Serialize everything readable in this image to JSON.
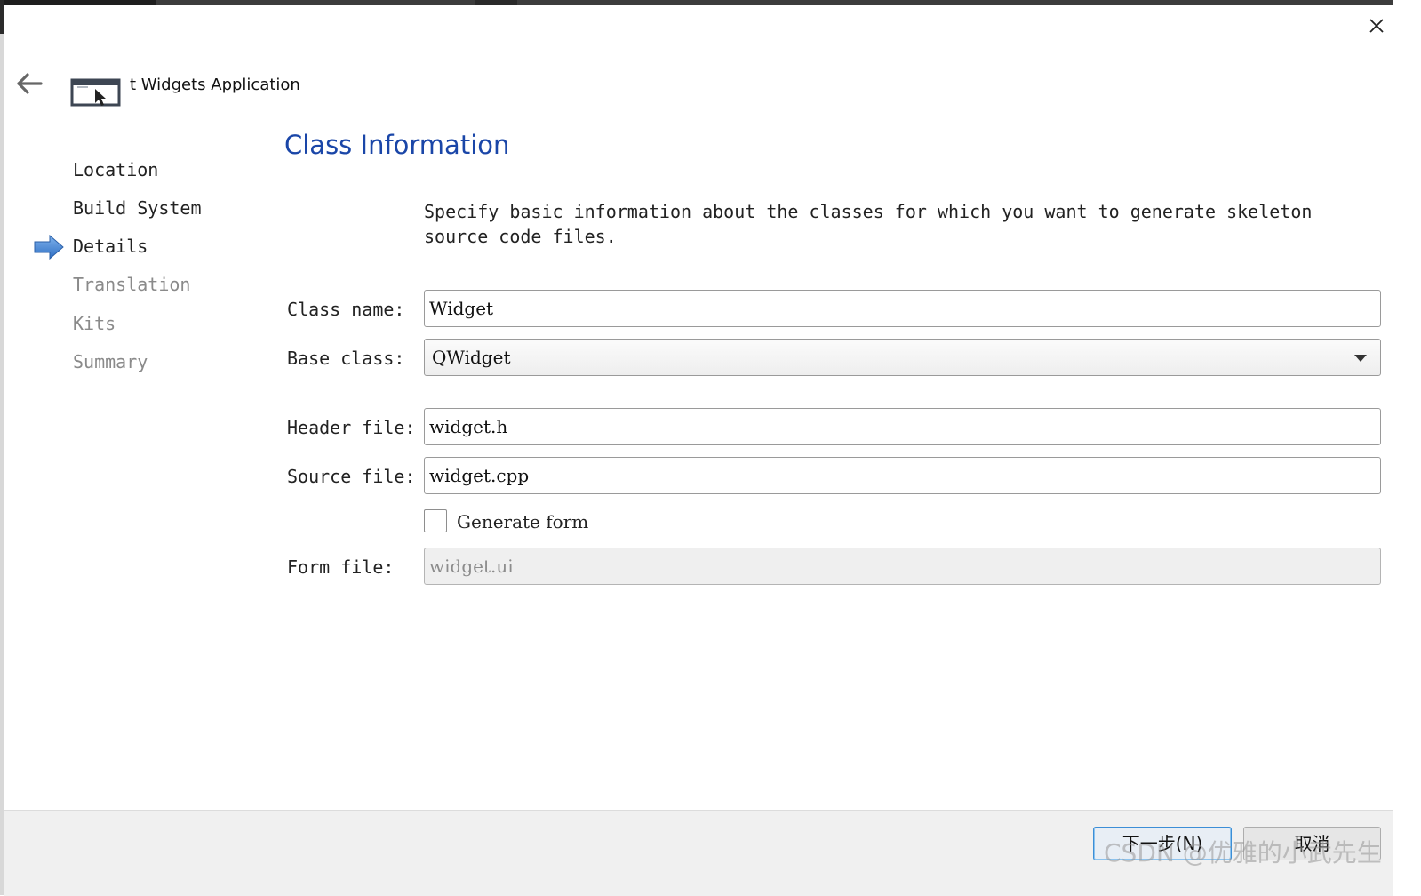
{
  "window": {
    "wizard_title": "t Widgets Application"
  },
  "steps": [
    {
      "label": "Location",
      "state": "done"
    },
    {
      "label": "Build System",
      "state": "done"
    },
    {
      "label": "Details",
      "state": "current"
    },
    {
      "label": "Translation",
      "state": "pending"
    },
    {
      "label": "Kits",
      "state": "pending"
    },
    {
      "label": "Summary",
      "state": "pending"
    }
  ],
  "page": {
    "title": "Class Information",
    "description": "Specify basic information about the classes for which you want to generate skeleton source code files."
  },
  "form": {
    "class_name": {
      "label": "Class name:",
      "value": "Widget"
    },
    "base_class": {
      "label": "Base class:",
      "value": "QWidget"
    },
    "header_file": {
      "label": "Header file:",
      "value": "widget.h"
    },
    "source_file": {
      "label": "Source file:",
      "value": "widget.cpp"
    },
    "generate_form": {
      "label": "Generate form",
      "checked": false
    },
    "form_file": {
      "label": "Form file:",
      "value": "widget.ui",
      "disabled": true
    }
  },
  "footer": {
    "next_label": "下一步(N)",
    "cancel_label": "取消"
  },
  "watermark": "CSDN @优雅的小武先生",
  "colors": {
    "title_blue": "#1a46a8",
    "arrow_blue": "#3a7fd5",
    "disabled_text": "#8a8a8a",
    "footer_bg": "#f0f0f0"
  },
  "icons": {
    "close": "close-icon",
    "back": "arrow-left-icon",
    "app": "window-cursor-icon",
    "current_step": "arrow-right-icon",
    "dropdown": "caret-down-icon"
  }
}
